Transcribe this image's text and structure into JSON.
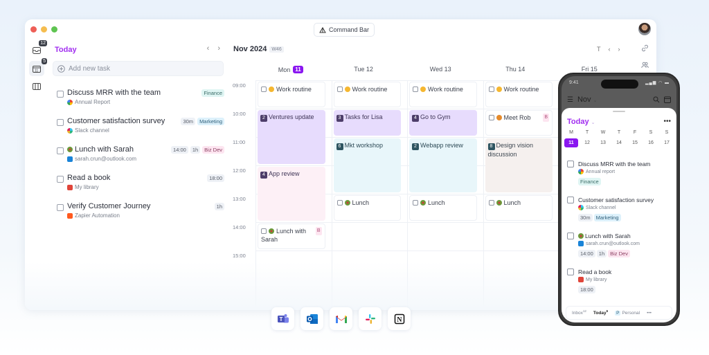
{
  "window": {
    "traffic_colors": [
      "#ee5f57",
      "#f5bd4f",
      "#5fc451"
    ],
    "command_bar_label": "Command Bar",
    "avatar": "user-avatar"
  },
  "rail": {
    "items": [
      {
        "icon": "inbox-icon",
        "badge": "12"
      },
      {
        "icon": "calendar-today-icon",
        "badge": "5",
        "active": true
      },
      {
        "icon": "columns-icon"
      }
    ]
  },
  "left": {
    "heading": "Today",
    "prev": "‹",
    "next": "›",
    "add_task_placeholder": "Add new task",
    "tasks": [
      {
        "title": "Discuss MRR with the team",
        "source": "Annual Report",
        "source_icon": "google-icon",
        "tags": [
          {
            "label": "Finance",
            "kind": "finance"
          }
        ]
      },
      {
        "title": "Customer satisfaction survey",
        "source": "Slack channel",
        "source_icon": "slack-icon",
        "tags": [
          {
            "label": "30m",
            "kind": "plain"
          },
          {
            "label": "Marketing",
            "kind": "marketing"
          }
        ]
      },
      {
        "title": "Lunch with Sarah",
        "emoji": "salad-emoji",
        "source": "sarah.crun@outlook.com",
        "source_icon": "outlook-icon",
        "tags": [
          {
            "label": "14:00",
            "kind": "plain"
          },
          {
            "label": "1h",
            "kind": "plain"
          },
          {
            "label": "Biz Dev",
            "kind": "bizdev"
          }
        ]
      },
      {
        "title": "Read a book",
        "source": "My library",
        "source_icon": "library-icon",
        "tags": [
          {
            "label": "18:00",
            "kind": "plain"
          }
        ]
      },
      {
        "title": "Verify Customer Journey",
        "source": "Zapier Automation",
        "source_icon": "zapier-icon",
        "tags": [
          {
            "label": "1h",
            "kind": "plain"
          }
        ]
      }
    ]
  },
  "calendar": {
    "title": "Nov 2024",
    "week": "W46",
    "today_btn": "T",
    "prev": "‹",
    "next": "›",
    "days": [
      {
        "label": "Mon",
        "num": "11",
        "today": true
      },
      {
        "label": "Tue 12"
      },
      {
        "label": "Wed 13"
      },
      {
        "label": "Thu 14"
      },
      {
        "label": "Fri 15"
      }
    ],
    "hours": [
      "09:00",
      "10:00",
      "11:00",
      "12:00",
      "13:00",
      "14:00",
      "15:00"
    ],
    "events": [
      {
        "day": 0,
        "start": 9,
        "end": 10,
        "title": "Work routine",
        "style": "white",
        "checkbox": true,
        "emoji": "smile"
      },
      {
        "day": 1,
        "start": 9,
        "end": 10,
        "title": "Work routine",
        "style": "white",
        "checkbox": true,
        "emoji": "smile"
      },
      {
        "day": 2,
        "start": 9,
        "end": 10,
        "title": "Work routine",
        "style": "white",
        "checkbox": true,
        "emoji": "smile"
      },
      {
        "day": 3,
        "start": 9,
        "end": 10,
        "title": "Work routine",
        "style": "white",
        "checkbox": true,
        "emoji": "smile"
      },
      {
        "day": 0,
        "start": 10,
        "end": 12,
        "title": "Ventures update",
        "style": "purple",
        "num": "2"
      },
      {
        "day": 1,
        "start": 10,
        "end": 11,
        "title": "Tasks for Lisa",
        "style": "purple",
        "num": "3"
      },
      {
        "day": 2,
        "start": 10,
        "end": 11,
        "title": "Go to Gym",
        "style": "purple",
        "num": "4"
      },
      {
        "day": 3,
        "start": 10,
        "end": 11,
        "title": "Meet Rob",
        "style": "white",
        "checkbox": true,
        "emoji": "croissant",
        "flag": "B"
      },
      {
        "day": 1,
        "start": 11,
        "end": 13,
        "title": "Mkt workshop",
        "style": "cyan",
        "num": "6",
        "num_style": "teal"
      },
      {
        "day": 2,
        "start": 11,
        "end": 13,
        "title": "Webapp review",
        "style": "cyan",
        "num": "2",
        "num_style": "teal"
      },
      {
        "day": 3,
        "start": 11,
        "end": 13,
        "title": "Design vision discussion",
        "style": "beige",
        "num": "8",
        "num_style": "teal"
      },
      {
        "day": 0,
        "start": 12,
        "end": 14,
        "title": "App review",
        "style": "pink",
        "num": "4"
      },
      {
        "day": 1,
        "start": 13,
        "end": 14,
        "title": "Lunch",
        "style": "white",
        "checkbox": true,
        "emoji": "salad"
      },
      {
        "day": 2,
        "start": 13,
        "end": 14,
        "title": "Lunch",
        "style": "white",
        "checkbox": true,
        "emoji": "salad"
      },
      {
        "day": 3,
        "start": 13,
        "end": 14,
        "title": "Lunch",
        "style": "white",
        "checkbox": true,
        "emoji": "salad"
      },
      {
        "day": 0,
        "start": 14,
        "end": 15,
        "title": "Lunch with Sarah",
        "style": "white",
        "checkbox": true,
        "emoji": "salad",
        "flag": "B"
      }
    ]
  },
  "phone": {
    "time": "9:41",
    "month": "Nov",
    "heading": "Today",
    "more": "•••",
    "weekdays": [
      "M",
      "T",
      "W",
      "T",
      "F",
      "S",
      "S"
    ],
    "dates": [
      "11",
      "12",
      "13",
      "14",
      "15",
      "16",
      "17"
    ],
    "selected_index": 0,
    "tasks": [
      {
        "title": "Discuss MRR with the team",
        "source": "Annual report",
        "source_icon": "google-icon",
        "tags": [
          {
            "label": "Finance",
            "kind": "finance"
          }
        ]
      },
      {
        "title": "Customer satisfaction survey",
        "source": "Slack channel",
        "source_icon": "slack-icon",
        "tags": [
          {
            "label": "30m",
            "kind": "plain"
          },
          {
            "label": "Marketing",
            "kind": "marketing"
          }
        ]
      },
      {
        "title": "Lunch with Sarah",
        "emoji": "salad-emoji",
        "source": "sarah.crun@outlook.com",
        "source_icon": "outlook-icon",
        "tags": [
          {
            "label": "14:00",
            "kind": "plain"
          },
          {
            "label": "1h",
            "kind": "plain"
          },
          {
            "label": "Biz Dev",
            "kind": "bizdev"
          }
        ]
      },
      {
        "title": "Read a book",
        "source": "My library",
        "source_icon": "library-icon",
        "tags": [
          {
            "label": "18:00",
            "kind": "plain"
          }
        ]
      }
    ],
    "tabs": {
      "inbox": "Inbox",
      "inbox_count": "12",
      "today": "Today",
      "today_count": "5",
      "personal_badge": "P",
      "personal": "Personal",
      "more": "•••"
    }
  },
  "integrations": [
    "microsoft-teams",
    "outlook",
    "gmail",
    "slack",
    "notion"
  ],
  "colors": {
    "accent": "#8a16f0",
    "today_text": "#a12df0"
  }
}
